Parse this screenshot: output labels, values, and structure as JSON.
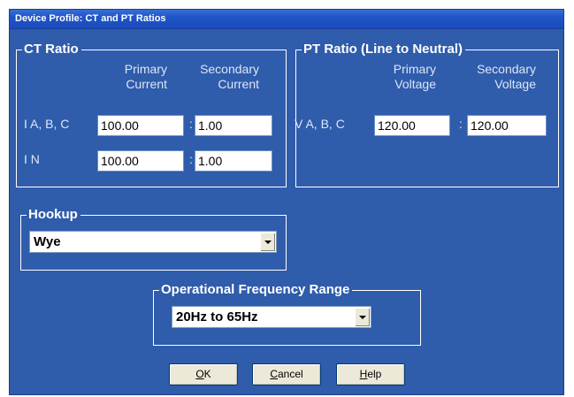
{
  "window": {
    "title": "Device Profile: CT and PT Ratios"
  },
  "ct_ratio": {
    "legend": "CT Ratio",
    "col_primary": [
      "Primary",
      "Current"
    ],
    "col_secondary": [
      "Secondary",
      "Current"
    ],
    "rows": [
      {
        "label": "I A, B, C",
        "primary": "100.00",
        "secondary": "1.00"
      },
      {
        "label": "I N",
        "primary": "100.00",
        "secondary": "1.00"
      }
    ],
    "separator": ":"
  },
  "pt_ratio": {
    "legend": "PT Ratio (Line to Neutral)",
    "col_primary": [
      "Primary",
      "Voltage"
    ],
    "col_secondary": [
      "Secondary",
      "Voltage"
    ],
    "row": {
      "label": "V A, B, C",
      "primary": "120.00",
      "secondary": "120.00"
    },
    "separator": ":"
  },
  "hookup": {
    "legend": "Hookup",
    "selected": "Wye",
    "icon": "chevron-down-icon"
  },
  "frequency": {
    "legend": "Operational Frequency Range",
    "selected": "20Hz to 65Hz",
    "icon": "chevron-down-icon"
  },
  "buttons": {
    "ok": {
      "mnemonic": "O",
      "rest": "K"
    },
    "cancel": {
      "mnemonic": "C",
      "rest": "ancel"
    },
    "help": {
      "mnemonic": "H",
      "rest": "elp"
    }
  },
  "colors": {
    "dialog_background": "#2f5cab",
    "titlebar": "#1f54c8",
    "button_face": "#ece9d8"
  }
}
